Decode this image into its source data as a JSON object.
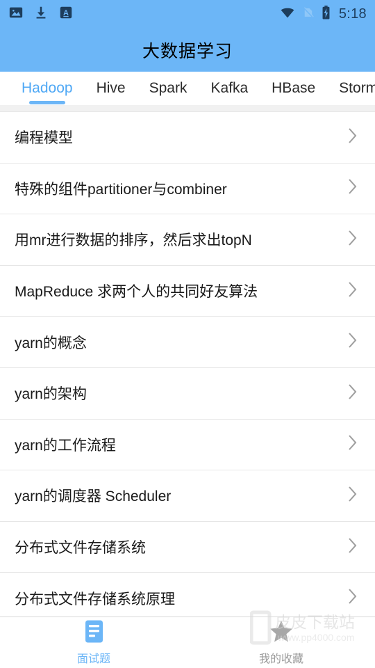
{
  "status_bar": {
    "icons_left": [
      "image-icon",
      "download-icon",
      "a-letter-icon"
    ],
    "icons_right": [
      "wifi-icon",
      "no-sim-icon",
      "battery-charging-icon"
    ],
    "time": "5:18"
  },
  "header": {
    "title": "大数据学习",
    "background_color": "#6CB6F7",
    "title_color": "#000000"
  },
  "tabs": {
    "active_index": 0,
    "active_color": "#4FA8F5",
    "indicator_color": "#6CB6F7",
    "items": [
      {
        "label": "Hadoop"
      },
      {
        "label": "Hive"
      },
      {
        "label": "Spark"
      },
      {
        "label": "Kafka"
      },
      {
        "label": "HBase"
      },
      {
        "label": "Storm"
      }
    ]
  },
  "list": {
    "chevron_icon": "chevron-right-icon",
    "items": [
      {
        "label": "编程模型"
      },
      {
        "label": "特殊的组件partitioner与combiner"
      },
      {
        "label": "用mr进行数据的排序，然后求出topN"
      },
      {
        "label": "MapReduce 求两个人的共同好友算法"
      },
      {
        "label": "yarn的概念"
      },
      {
        "label": "yarn的架构"
      },
      {
        "label": "yarn的工作流程"
      },
      {
        "label": "yarn的调度器 Scheduler"
      },
      {
        "label": "分布式文件存储系统"
      },
      {
        "label": "分布式文件存储系统原理"
      }
    ]
  },
  "bottom_nav": {
    "active_index": 0,
    "active_color": "#6CB6F7",
    "inactive_color": "#9A9A9A",
    "items": [
      {
        "label": "面试题",
        "icon": "document-lines-icon"
      },
      {
        "label": "我的收藏",
        "icon": "star-icon"
      }
    ]
  },
  "watermark": {
    "text": "皮皮下载站",
    "url": "www.pp4000.com"
  }
}
